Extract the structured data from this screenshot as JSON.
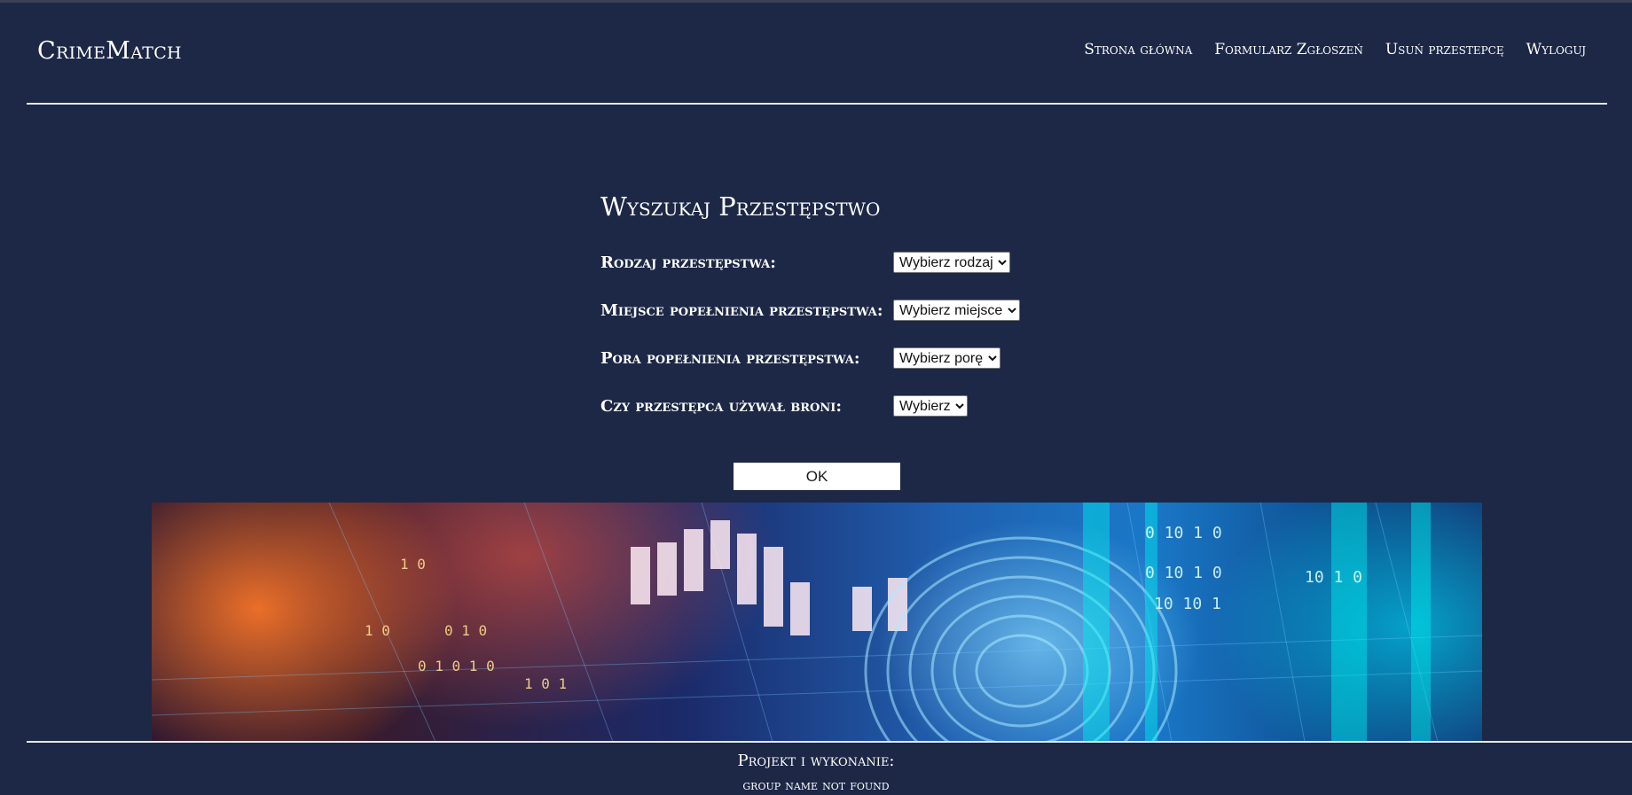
{
  "header": {
    "brand": "CrimeMatch",
    "nav": [
      {
        "label": "Strona główna"
      },
      {
        "label": "Formularz Zgłoszeń"
      },
      {
        "label": "Usuń przestepcę"
      },
      {
        "label": "Wyloguj"
      }
    ]
  },
  "form": {
    "title": "Wyszukaj Przestępstwo",
    "fields": [
      {
        "label": "Rodzaj przestępstwa:",
        "selected": "Wybierz rodzaj"
      },
      {
        "label": "Miejsce popełnienia przestępstwa:",
        "selected": "Wybierz miejsce"
      },
      {
        "label": "Pora popełnienia przestępstwa:",
        "selected": "Wybierz porę"
      },
      {
        "label": "Czy przestępca używał broni:",
        "selected": "Wybierz"
      }
    ],
    "submit_label": "OK"
  },
  "banner": {
    "description_icon": "digital-fingerprint-banner"
  },
  "footer": {
    "line1": "Projekt i wykonanie:",
    "line2": "group name not found"
  },
  "colors": {
    "background": "#1d2746",
    "text": "#ffffff",
    "button": "#ffffff"
  }
}
